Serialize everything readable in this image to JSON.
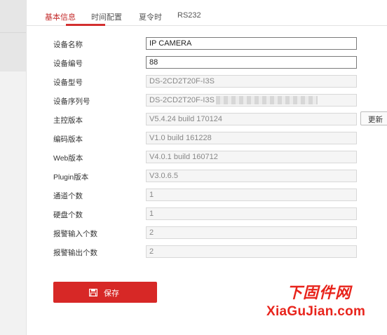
{
  "tabs": [
    {
      "label": "基本信息",
      "active": true
    },
    {
      "label": "时间配置",
      "active": false
    },
    {
      "label": "夏令时",
      "active": false
    },
    {
      "label": "RS232",
      "active": false
    }
  ],
  "form": {
    "device_name": {
      "label": "设备名称",
      "value": "IP CAMERA"
    },
    "device_number": {
      "label": "设备编号",
      "value": "88"
    },
    "device_model": {
      "label": "设备型号",
      "value": "DS-2CD2T20F-I3S"
    },
    "serial_number": {
      "label": "设备序列号",
      "value": "DS-2CD2T20F-I3S"
    },
    "firmware_version": {
      "label": "主控版本",
      "value": "V5.4.24 build 170124"
    },
    "encoding_version": {
      "label": "编码版本",
      "value": "V1.0 build 161228"
    },
    "web_version": {
      "label": "Web版本",
      "value": "V4.0.1 build 160712"
    },
    "plugin_version": {
      "label": "Plugin版本",
      "value": "V3.0.6.5"
    },
    "channel_count": {
      "label": "通道个数",
      "value": "1"
    },
    "disk_count": {
      "label": "硬盘个数",
      "value": "1"
    },
    "alarm_input_count": {
      "label": "报警输入个数",
      "value": "2"
    },
    "alarm_output_count": {
      "label": "报警输出个数",
      "value": "2"
    }
  },
  "update_button_label": "更新",
  "save_button_label": "保存",
  "watermark": {
    "line1": "下固件网",
    "line2": "XiaGuJian.com"
  },
  "colors": {
    "accent": "#d72826",
    "active_tab": "#c32a2a",
    "watermark": "#e8241c"
  },
  "icons": {
    "save": "floppy-disk-icon"
  }
}
